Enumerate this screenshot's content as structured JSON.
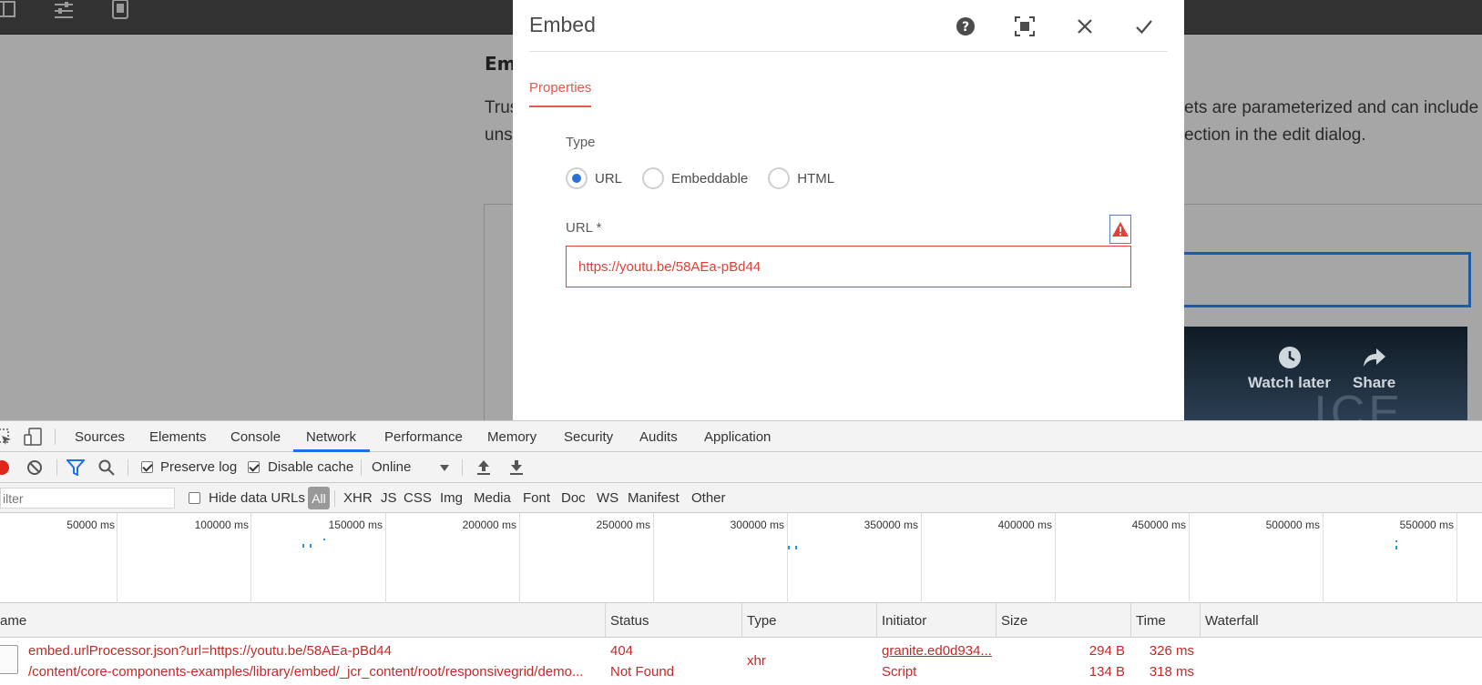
{
  "background_page": {
    "heading": "Em",
    "text_left_line1": "Trus",
    "text_left_line2": "uns",
    "text_right_line1": "ets are parameterized and can include",
    "text_right_line2": "ection in the edit dialog.",
    "video_watch_later": "Watch later",
    "video_share": "Share",
    "video_big_text": "ICE"
  },
  "dialog": {
    "title": "Embed",
    "tab": "Properties",
    "type_label": "Type",
    "radio_options": [
      "URL",
      "Embeddable",
      "HTML"
    ],
    "selected_option": "URL",
    "url_label": "URL *",
    "url_value": "https://youtu.be/58AEa-pBd44"
  },
  "devtools": {
    "tabs": [
      "Sources",
      "Elements",
      "Console",
      "Network",
      "Performance",
      "Memory",
      "Security",
      "Audits",
      "Application"
    ],
    "active_tab": "Network",
    "toolbar": {
      "preserve_log": "Preserve log",
      "disable_cache": "Disable cache",
      "throttle": "Online"
    },
    "filter": {
      "placeholder": "ilter",
      "hide_data_urls": "Hide data URLs",
      "types": [
        "All",
        "XHR",
        "JS",
        "CSS",
        "Img",
        "Media",
        "Font",
        "Doc",
        "WS",
        "Manifest",
        "Other"
      ]
    },
    "timeline_labels": [
      "50000 ms",
      "100000 ms",
      "150000 ms",
      "200000 ms",
      "250000 ms",
      "300000 ms",
      "350000 ms",
      "400000 ms",
      "450000 ms",
      "500000 ms",
      "550000 ms"
    ],
    "columns": [
      "ame",
      "Status",
      "Type",
      "Initiator",
      "Size",
      "Time",
      "Waterfall"
    ],
    "row": {
      "name_line1": "embed.urlProcessor.json?url=https://youtu.be/58AEa-pBd44",
      "name_line2": "/content/core-components-examples/library/embed/_jcr_content/root/responsivegrid/demo...",
      "status_line1": "404",
      "status_line2": "Not Found",
      "type": "xhr",
      "initiator_line1": "granite.ed0d934...",
      "initiator_line2": "Script",
      "size_line1": "294 B",
      "size_line2": "134 B",
      "time_line1": "326 ms",
      "time_line2": "318 ms"
    }
  },
  "colors": {
    "accent_red": "#e05a4b",
    "error_red": "#e0403a",
    "radio_blue": "#2d6fd6",
    "devtools_blue": "#1a73e8",
    "request_error": "#c62828"
  }
}
